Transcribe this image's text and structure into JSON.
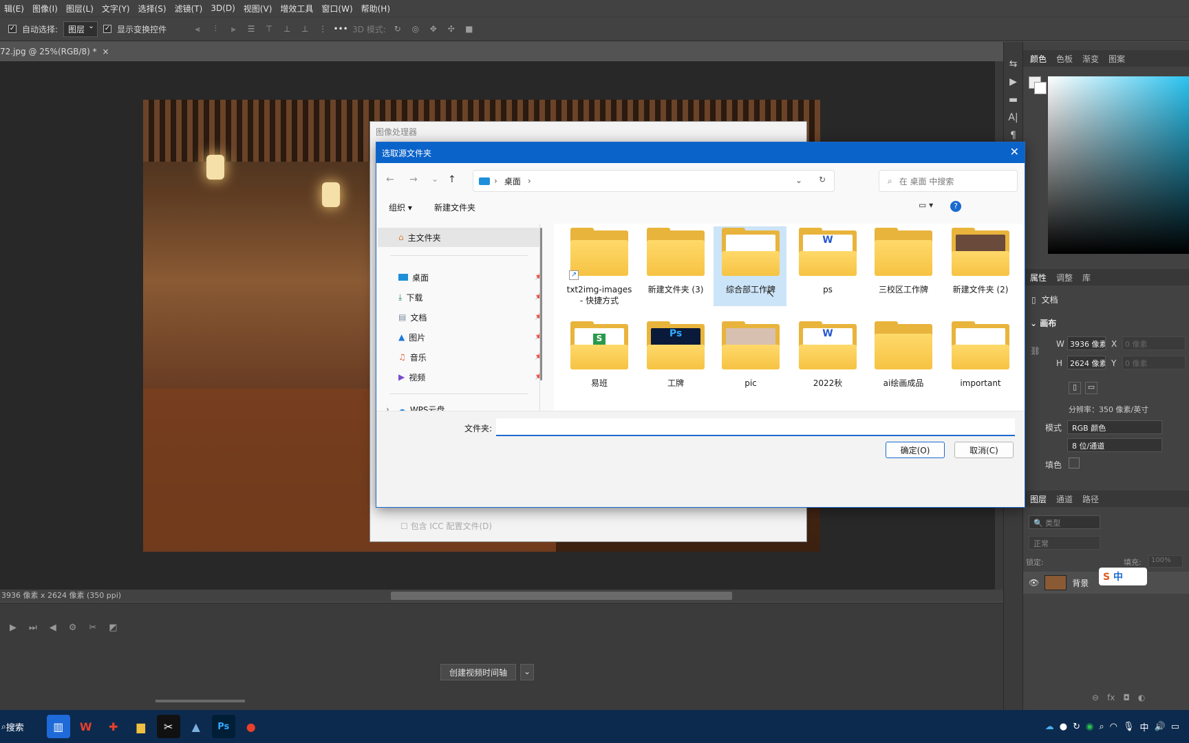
{
  "menu": [
    "辑(E)",
    "图像(I)",
    "图层(L)",
    "文字(Y)",
    "选择(S)",
    "滤镜(T)",
    "3D(D)",
    "视图(V)",
    "增效工具",
    "窗口(W)",
    "帮助(H)"
  ],
  "options": {
    "auto_select": "自动选择:",
    "layer_value": "图层",
    "show_transform": "显示变换控件",
    "mode3d": "3D 模式:"
  },
  "doc_tab": "72.jpg @ 25%(RGB/8) *",
  "status": "3936 像素 x 2624 像素 (350 ppi)",
  "timeline": {
    "create_btn": "创建视频时间轴"
  },
  "panels": {
    "color_tabs": [
      "颜色",
      "色板",
      "渐变",
      "图案"
    ],
    "prop_tabs": [
      "属性",
      "调整",
      "库"
    ],
    "doc_label": "文档",
    "canvas_label": "画布",
    "w_label": "W",
    "w_value": "3936 像素",
    "x_label": "X",
    "x_placeholder": "0 像素",
    "h_label": "H",
    "h_value": "2624 像素",
    "y_label": "Y",
    "y_placeholder": "0 像素",
    "resolution": "分辨率：350 像素/英寸",
    "mode_label": "模式",
    "mode_value": "RGB 颜色",
    "depth_value": "8 位/通道",
    "fill_label": "填色",
    "layer_tabs": [
      "图层",
      "通道",
      "路径"
    ],
    "layer_kind": "类型",
    "blend": "正常",
    "lock_label": "锁定:",
    "fill2": "填充:",
    "fill2_value": "100%",
    "layer_name": "背景"
  },
  "behind_dialog": {
    "title": "图像处理器",
    "icc": "包含 ICC 配置文件(D)"
  },
  "dialog": {
    "title": "选取源文件夹",
    "path": "桌面",
    "search_placeholder": "在 桌面 中搜索",
    "organize": "组织",
    "new_folder": "新建文件夹",
    "nav": {
      "home": "主文件夹",
      "desktop": "桌面",
      "downloads": "下载",
      "documents": "文档",
      "pictures": "图片",
      "music": "音乐",
      "videos": "视频",
      "wps": "WPS云盘"
    },
    "folders": [
      {
        "name": "txt2img-images - 快捷方式"
      },
      {
        "name": "新建文件夹 (3)"
      },
      {
        "name": "综合部工作牌"
      },
      {
        "name": "ps"
      },
      {
        "name": "三校区工作牌"
      },
      {
        "name": "新建文件夹 (2)"
      },
      {
        "name": "易班"
      },
      {
        "name": "工牌"
      },
      {
        "name": "pic"
      },
      {
        "name": "2022秋"
      },
      {
        "name": "ai绘画成品"
      },
      {
        "name": "important"
      }
    ],
    "folder_label": "文件夹:",
    "ok": "确定(O)",
    "cancel": "取消(C)"
  },
  "taskbar": {
    "search": "搜索",
    "ime": "中"
  }
}
